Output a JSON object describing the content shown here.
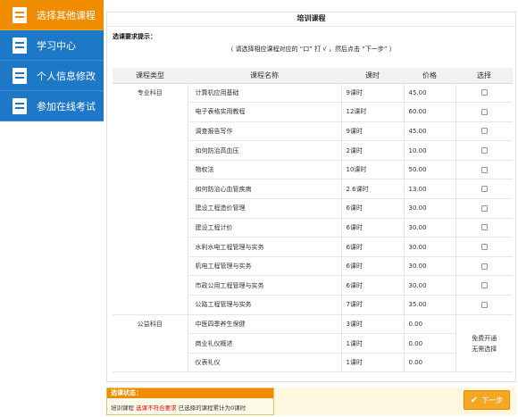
{
  "sidebar": {
    "items": [
      {
        "label": "选择其他课程",
        "icon": "edit-icon",
        "active": true
      },
      {
        "label": "学习中心",
        "icon": "document-icon",
        "active": false
      },
      {
        "label": "个人信息修改",
        "icon": "search-icon",
        "active": false
      },
      {
        "label": "参加在线考试",
        "icon": "document-icon",
        "active": false
      }
    ]
  },
  "main": {
    "title": "培训课程",
    "requirement_title": "选课要求提示：",
    "requirement_note": "（ 请选择相应课程对应的 “口” 打 √ ，然后点击 “下一步” ）",
    "headers": [
      "课程类型",
      "课程名称",
      "课时",
      "价格",
      "选择"
    ],
    "groups": [
      {
        "type": "专业科目",
        "courses": [
          {
            "name": "计算机应用基础",
            "hours": "9课时",
            "price": "45.00"
          },
          {
            "name": "电子表格实用教程",
            "hours": "12课时",
            "price": "60.00"
          },
          {
            "name": "调查报告写作",
            "hours": "9课时",
            "price": "45.00"
          },
          {
            "name": "如何防治高血压",
            "hours": "2课时",
            "price": "10.00"
          },
          {
            "name": "物权法",
            "hours": "10课时",
            "price": "50.00"
          },
          {
            "name": "如何防治心血管疾病",
            "hours": "2.6课时",
            "price": "13.00"
          },
          {
            "name": "建设工程造价管理",
            "hours": "6课时",
            "price": "30.00"
          },
          {
            "name": "建设工程计价",
            "hours": "6课时",
            "price": "30.00"
          },
          {
            "name": "水利水电工程管理与实务",
            "hours": "6课时",
            "price": "30.00"
          },
          {
            "name": "机电工程管理与实务",
            "hours": "6课时",
            "price": "30.00"
          },
          {
            "name": "市政公用工程管理与实务",
            "hours": "6课时",
            "price": "30.00"
          },
          {
            "name": "公路工程管理与实务",
            "hours": "7课时",
            "price": "35.00"
          }
        ]
      },
      {
        "type": "公益科目",
        "courses": [
          {
            "name": "中医四季养生保健",
            "hours": "3课时",
            "price": "0.00"
          },
          {
            "name": "商业礼仪概述",
            "hours": "1课时",
            "price": "0.00"
          },
          {
            "name": "仪表礼仪",
            "hours": "1课时",
            "price": "0.00"
          }
        ],
        "free_note_1": "免费开通",
        "free_note_2": "无需选择"
      }
    ]
  },
  "status": {
    "title": "选课状态：",
    "prefix": "培训课程",
    "warning": "选课不符合要求",
    "suffix": "已选择的课程累计为0课时"
  },
  "next_button": {
    "label": "下一步"
  },
  "colors": {
    "accent_orange": "#f08c00",
    "sidebar_blue": "#1e78c8",
    "warning_red": "#e00000"
  }
}
